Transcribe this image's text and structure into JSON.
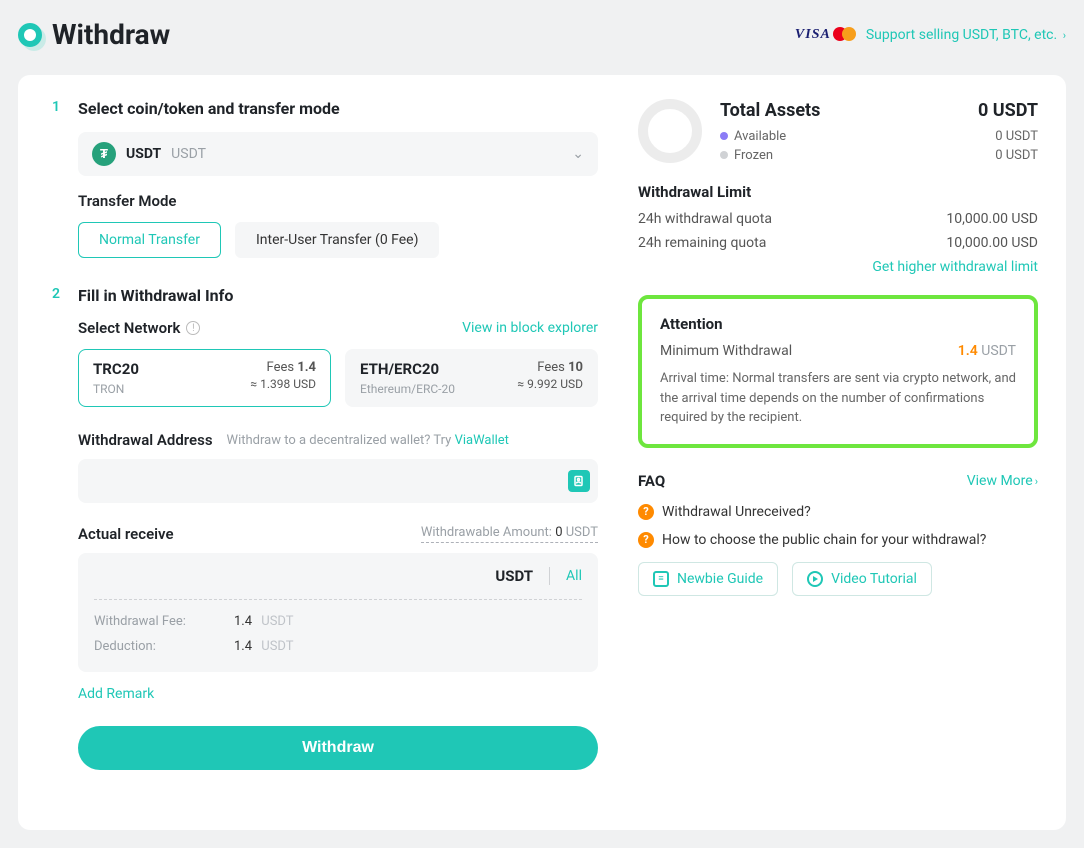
{
  "header": {
    "title": "Withdraw",
    "sell_link": "Support selling USDT, BTC, etc."
  },
  "step1": {
    "title": "Select coin/token and transfer mode",
    "coin_symbol": "USDT",
    "coin_name": "USDT",
    "transfer_mode_label": "Transfer Mode",
    "modes": [
      "Normal Transfer",
      "Inter-User Transfer (0 Fee)"
    ]
  },
  "step2": {
    "title": "Fill in Withdrawal Info",
    "select_network_label": "Select Network",
    "view_explorer": "View in block explorer",
    "networks": [
      {
        "name": "TRC20",
        "sub": "TRON",
        "fee": "1.4",
        "usd": "≈ 1.398 USD"
      },
      {
        "name": "ETH/ERC20",
        "sub": "Ethereum/ERC-20",
        "fee": "10",
        "usd": "≈ 9.992 USD"
      }
    ],
    "fees_word": "Fees",
    "address_label": "Withdrawal Address",
    "address_hint_prefix": "Withdraw to a decentralized wallet? Try ",
    "address_hint_link": "ViaWallet",
    "receive_label": "Actual receive",
    "withdrawable_label": "Withdrawable Amount:",
    "withdrawable_value": "0",
    "withdrawable_unit": "USDT",
    "unit": "USDT",
    "all": "All",
    "fee_label": "Withdrawal Fee:",
    "fee_value": "1.4",
    "fee_unit": "USDT",
    "deduction_label": "Deduction:",
    "deduction_value": "1.4",
    "deduction_unit": "USDT",
    "add_remark": "Add Remark",
    "withdraw_button": "Withdraw"
  },
  "assets": {
    "title": "Total Assets",
    "total": "0 USDT",
    "available_label": "Available",
    "available_value": "0 USDT",
    "frozen_label": "Frozen",
    "frozen_value": "0 USDT"
  },
  "limit": {
    "title": "Withdrawal Limit",
    "rows": [
      {
        "label": "24h withdrawal quota",
        "value": "10,000.00 USD"
      },
      {
        "label": "24h remaining quota",
        "value": "10,000.00 USD"
      }
    ],
    "higher": "Get higher withdrawal limit"
  },
  "attention": {
    "title": "Attention",
    "min_label": "Minimum Withdrawal",
    "min_value": "1.4",
    "min_unit": "USDT",
    "text": "Arrival time: Normal transfers are sent via crypto network, and the arrival time depends on the number of confirmations required by the recipient."
  },
  "faq": {
    "title": "FAQ",
    "view_more": "View More",
    "items": [
      "Withdrawal Unreceived?",
      "How to choose the public chain for your withdrawal?"
    ],
    "newbie": "Newbie Guide",
    "video": "Video Tutorial"
  }
}
